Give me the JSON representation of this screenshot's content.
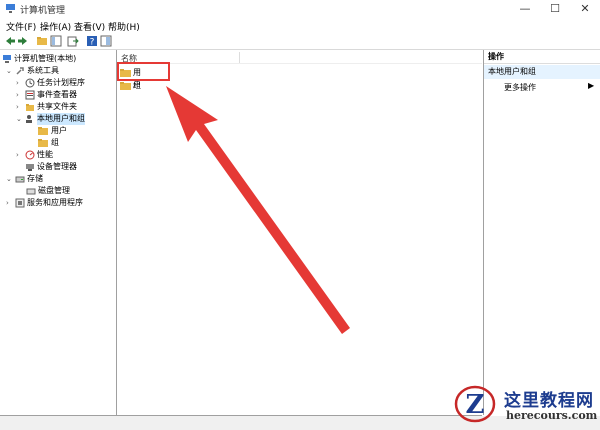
{
  "window": {
    "title": "计算机管理",
    "minimize_glyph": "—",
    "maximize_glyph": "☐",
    "close_glyph": "✕"
  },
  "menu": {
    "file": "文件(F)",
    "action": "操作(A)",
    "view": "查看(V)",
    "help": "帮助(H)"
  },
  "toolbar": {
    "back_glyph": "◀",
    "forward_glyph": "▶",
    "help_glyph": "?",
    "icons": [
      "back-icon",
      "forward-icon",
      "folder-up-icon",
      "show-tree-icon",
      "export-icon",
      "help-icon",
      "panel-icon"
    ]
  },
  "tree": {
    "root": "计算机管理(本地)",
    "system_tools": "系统工具",
    "task_scheduler": "任务计划程序",
    "event_viewer": "事件查看器",
    "shared_folders": "共享文件夹",
    "local_users_groups": "本地用户和组",
    "users": "用户",
    "groups": "组",
    "performance": "性能",
    "device_manager": "设备管理器",
    "storage": "存储",
    "disk_management": "磁盘管理",
    "services_apps": "服务和应用程序",
    "arrow_collapsed": "›",
    "arrow_expanded": "⌄"
  },
  "main": {
    "column_name": "名称",
    "items": [
      {
        "label": "用户"
      },
      {
        "label": "组"
      }
    ]
  },
  "actions": {
    "title": "操作",
    "section": "本地用户和组",
    "more": "更多操作",
    "more_arrow": "▶"
  },
  "watermark": {
    "letter": "Z",
    "name": "这里教程网",
    "url": "herecours.com"
  },
  "colors": {
    "highlight": "#e53935",
    "arrow": "#e53935",
    "selection": "#cce8ff",
    "folder": "#e8b948",
    "watermark_blue": "#1d3c8f"
  }
}
